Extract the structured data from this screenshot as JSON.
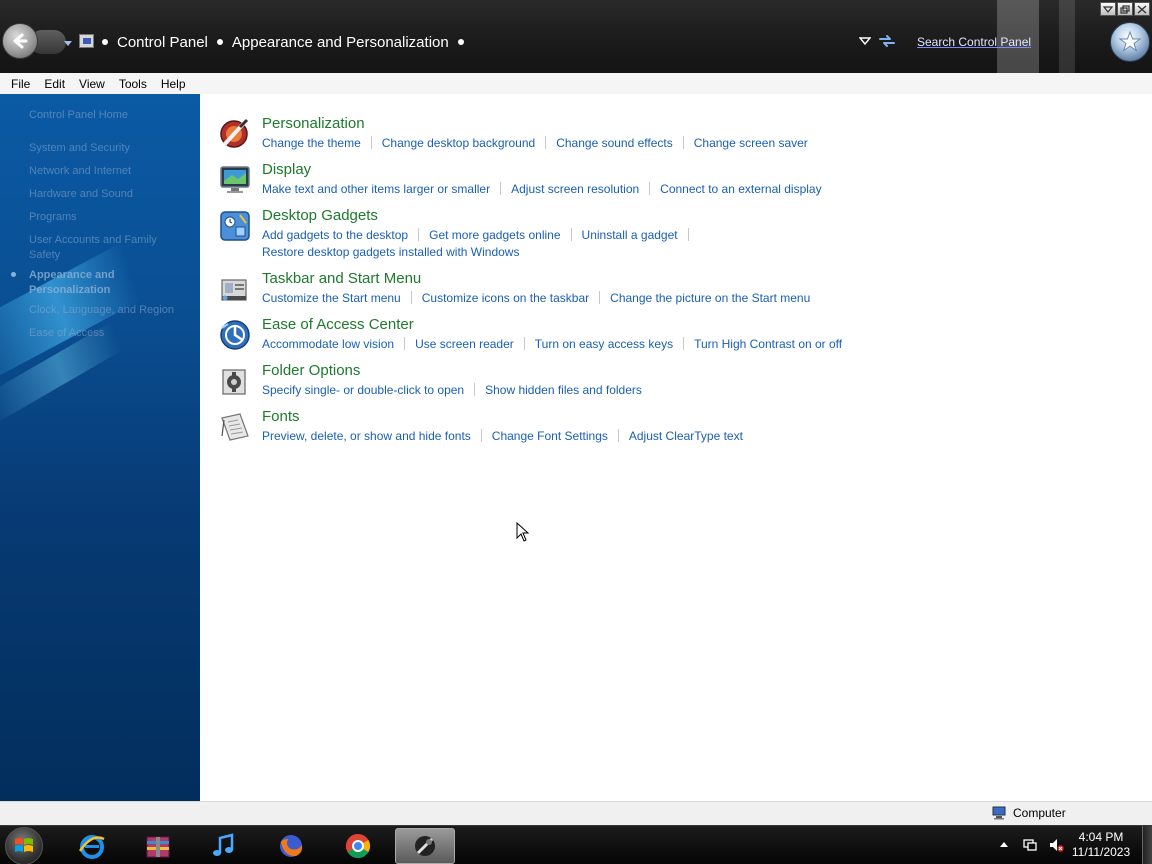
{
  "address_bar": {
    "breadcrumbs": [
      "Control Panel",
      "Appearance and Personalization"
    ],
    "search_placeholder": "Search Control Panel"
  },
  "menu": [
    "File",
    "Edit",
    "View",
    "Tools",
    "Help"
  ],
  "left_nav": {
    "items": [
      {
        "label": "Control Panel Home"
      },
      {
        "label": "System and Security"
      },
      {
        "label": "Network and Internet"
      },
      {
        "label": "Hardware and Sound"
      },
      {
        "label": "Programs"
      },
      {
        "label": "User Accounts and Family"
      },
      {
        "label": "Safety"
      },
      {
        "label": "Appearance and"
      },
      {
        "label": "Personalization"
      },
      {
        "label": "Clock, Language, and Region"
      },
      {
        "label": "Ease of Access"
      }
    ]
  },
  "categories": [
    {
      "title": "Personalization",
      "icon": "personalization-icon",
      "links": [
        [
          "Change the theme",
          "Change desktop background",
          "Change sound effects",
          "Change screen saver"
        ]
      ]
    },
    {
      "title": "Display",
      "icon": "display-icon",
      "links": [
        [
          "Make text and other items larger or smaller",
          "Adjust screen resolution",
          "Connect to an external display"
        ]
      ]
    },
    {
      "title": "Desktop Gadgets",
      "icon": "desktop-gadgets-icon",
      "links": [
        [
          "Add gadgets to the desktop",
          "Get more gadgets online",
          "Uninstall a gadget"
        ],
        [
          "Restore desktop gadgets installed with Windows"
        ]
      ]
    },
    {
      "title": "Taskbar and Start Menu",
      "icon": "taskbar-icon",
      "links": [
        [
          "Customize the Start menu",
          "Customize icons on the taskbar",
          "Change the picture on the Start menu"
        ]
      ]
    },
    {
      "title": "Ease of Access Center",
      "icon": "ease-of-access-icon",
      "links": [
        [
          "Accommodate low vision",
          "Use screen reader",
          "Turn on easy access keys",
          "Turn High Contrast on or off"
        ]
      ]
    },
    {
      "title": "Folder Options",
      "icon": "folder-options-icon",
      "links": [
        [
          "Specify single- or double-click to open",
          "Show hidden files and folders"
        ]
      ]
    },
    {
      "title": "Fonts",
      "icon": "fonts-icon",
      "links": [
        [
          "Preview, delete, or show and hide fonts",
          "Change Font Settings",
          "Adjust ClearType text"
        ]
      ]
    }
  ],
  "status_bar": {
    "location": "Computer"
  },
  "taskbar": {
    "apps": [
      "internet-explorer-icon",
      "archive-icon",
      "itunes-icon",
      "firefox-icon",
      "chrome-icon",
      "control-panel-icon"
    ],
    "time": "4:04 PM",
    "date": "11/11/2023"
  },
  "colors": {
    "title_green": "#1e7a2c",
    "link_blue": "#1a5fb4",
    "nav_blue": "#0a4f93"
  }
}
